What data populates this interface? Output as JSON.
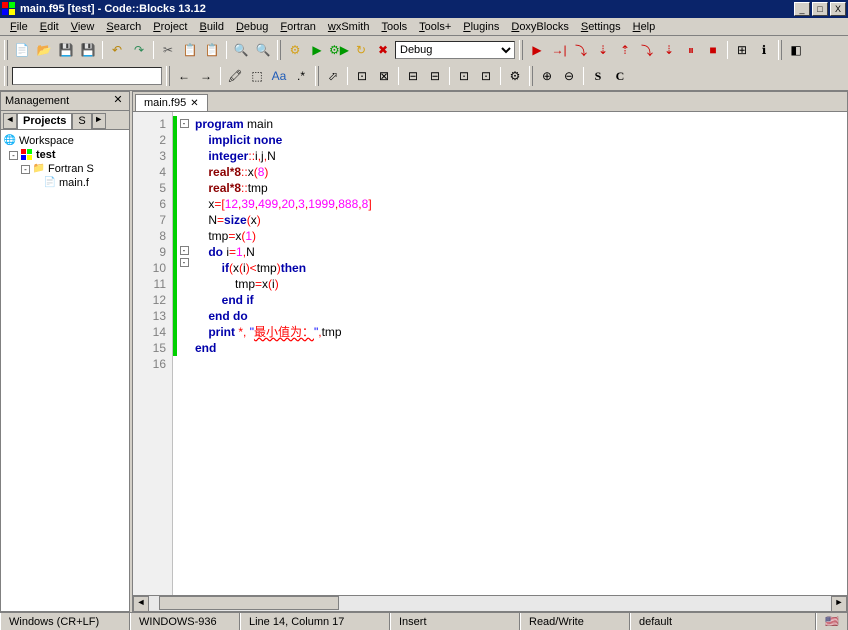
{
  "title": "main.f95 [test] - Code::Blocks 13.12",
  "menu": [
    "File",
    "Edit",
    "View",
    "Search",
    "Project",
    "Build",
    "Debug",
    "Fortran",
    "wxSmith",
    "Tools",
    "Tools+",
    "Plugins",
    "DoxyBlocks",
    "Settings",
    "Help"
  ],
  "build_target": "Debug",
  "management": {
    "title": "Management",
    "tabs_nav_left": "◄",
    "tabs_nav_right": "►",
    "tab_active": "Projects",
    "tab_other": "S",
    "tree": {
      "workspace": "Workspace",
      "project": "test",
      "folder": "Fortran S",
      "file": "main.f"
    }
  },
  "editor": {
    "tab_name": "main.f95",
    "line_count": 16,
    "code": [
      {
        "n": 1,
        "fold": "-",
        "t": [
          {
            "c": "kw",
            "s": "program"
          },
          {
            "c": "id",
            "s": " main"
          }
        ]
      },
      {
        "n": 2,
        "t": [
          {
            "c": "id",
            "s": "    "
          },
          {
            "c": "kw",
            "s": "implicit none"
          }
        ]
      },
      {
        "n": 3,
        "t": [
          {
            "c": "id",
            "s": "    "
          },
          {
            "c": "kw",
            "s": "integer"
          },
          {
            "c": "op",
            "s": "::"
          },
          {
            "c": "id",
            "s": "i"
          },
          {
            "c": "op",
            "s": ","
          },
          {
            "c": "id",
            "s": "j"
          },
          {
            "c": "op",
            "s": ","
          },
          {
            "c": "id",
            "s": "N"
          }
        ]
      },
      {
        "n": 4,
        "t": [
          {
            "c": "id",
            "s": "    "
          },
          {
            "c": "ty",
            "s": "real*8"
          },
          {
            "c": "op",
            "s": "::"
          },
          {
            "c": "id",
            "s": "x"
          },
          {
            "c": "op",
            "s": "("
          },
          {
            "c": "num",
            "s": "8"
          },
          {
            "c": "op",
            "s": ")"
          }
        ]
      },
      {
        "n": 5,
        "t": [
          {
            "c": "id",
            "s": "    "
          },
          {
            "c": "ty",
            "s": "real*8"
          },
          {
            "c": "op",
            "s": "::"
          },
          {
            "c": "id",
            "s": "tmp"
          }
        ]
      },
      {
        "n": 6,
        "t": [
          {
            "c": "id",
            "s": "    x"
          },
          {
            "c": "op",
            "s": "=["
          },
          {
            "c": "num",
            "s": "12"
          },
          {
            "c": "op",
            "s": ","
          },
          {
            "c": "num",
            "s": "39"
          },
          {
            "c": "op",
            "s": ","
          },
          {
            "c": "num",
            "s": "499"
          },
          {
            "c": "op",
            "s": ","
          },
          {
            "c": "num",
            "s": "20"
          },
          {
            "c": "op",
            "s": ","
          },
          {
            "c": "num",
            "s": "3"
          },
          {
            "c": "op",
            "s": ","
          },
          {
            "c": "num",
            "s": "1999"
          },
          {
            "c": "op",
            "s": ","
          },
          {
            "c": "num",
            "s": "888"
          },
          {
            "c": "op",
            "s": ","
          },
          {
            "c": "num",
            "s": "8"
          },
          {
            "c": "op",
            "s": "]"
          }
        ]
      },
      {
        "n": 7,
        "t": [
          {
            "c": "id",
            "s": "    N"
          },
          {
            "c": "op",
            "s": "="
          },
          {
            "c": "kw",
            "s": "size"
          },
          {
            "c": "op",
            "s": "("
          },
          {
            "c": "id",
            "s": "x"
          },
          {
            "c": "op",
            "s": ")"
          }
        ]
      },
      {
        "n": 8,
        "t": [
          {
            "c": "id",
            "s": "    tmp"
          },
          {
            "c": "op",
            "s": "="
          },
          {
            "c": "id",
            "s": "x"
          },
          {
            "c": "op",
            "s": "("
          },
          {
            "c": "num",
            "s": "1"
          },
          {
            "c": "op",
            "s": ")"
          }
        ]
      },
      {
        "n": 9,
        "fold": "-",
        "t": [
          {
            "c": "id",
            "s": "    "
          },
          {
            "c": "kw",
            "s": "do"
          },
          {
            "c": "id",
            "s": " i"
          },
          {
            "c": "op",
            "s": "="
          },
          {
            "c": "num",
            "s": "1"
          },
          {
            "c": "op",
            "s": ","
          },
          {
            "c": "id",
            "s": "N"
          }
        ]
      },
      {
        "n": 10,
        "fold": "-",
        "t": [
          {
            "c": "id",
            "s": "        "
          },
          {
            "c": "kw",
            "s": "if"
          },
          {
            "c": "op",
            "s": "("
          },
          {
            "c": "id",
            "s": "x"
          },
          {
            "c": "op",
            "s": "("
          },
          {
            "c": "id",
            "s": "i"
          },
          {
            "c": "op",
            "s": ")<"
          },
          {
            "c": "id",
            "s": "tmp"
          },
          {
            "c": "op",
            "s": ")"
          },
          {
            "c": "kw",
            "s": "then"
          }
        ]
      },
      {
        "n": 11,
        "t": [
          {
            "c": "id",
            "s": "            tmp"
          },
          {
            "c": "op",
            "s": "="
          },
          {
            "c": "id",
            "s": "x"
          },
          {
            "c": "op",
            "s": "("
          },
          {
            "c": "id",
            "s": "i"
          },
          {
            "c": "op",
            "s": ")"
          }
        ]
      },
      {
        "n": 12,
        "t": [
          {
            "c": "id",
            "s": "        "
          },
          {
            "c": "kw",
            "s": "end if"
          }
        ]
      },
      {
        "n": 13,
        "t": [
          {
            "c": "id",
            "s": "    "
          },
          {
            "c": "kw",
            "s": "end do"
          }
        ]
      },
      {
        "n": 14,
        "t": [
          {
            "c": "id",
            "s": "    "
          },
          {
            "c": "kw",
            "s": "print"
          },
          {
            "c": "id",
            "s": " "
          },
          {
            "c": "op",
            "s": "*, "
          },
          {
            "c": "str",
            "s": "\""
          },
          {
            "c": "zh",
            "s": "最小值为："
          },
          {
            "c": "str",
            "s": "\""
          },
          {
            "c": "op",
            "s": ","
          },
          {
            "c": "id",
            "s": "tmp"
          }
        ]
      },
      {
        "n": 15,
        "t": [
          {
            "c": "kw",
            "s": "end"
          }
        ]
      },
      {
        "n": 16,
        "t": [
          {
            "c": "id",
            "s": ""
          }
        ]
      }
    ]
  },
  "status": {
    "eol": "Windows (CR+LF)",
    "encoding": "WINDOWS-936",
    "pos": "Line 14, Column 17",
    "ins": "Insert",
    "rw": "Read/Write",
    "lang": "default"
  }
}
